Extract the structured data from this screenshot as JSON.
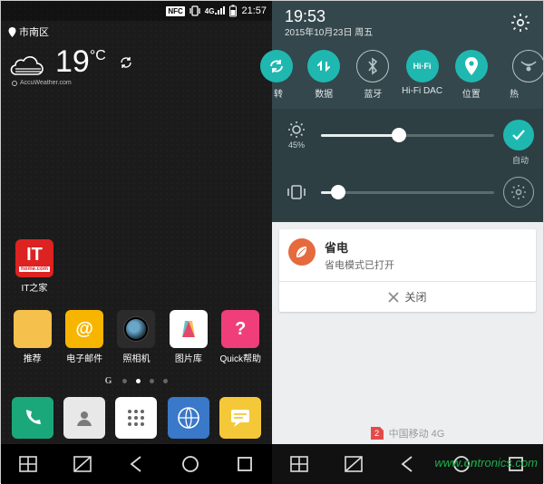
{
  "left": {
    "status": {
      "nfc": "NFC",
      "clock": "21:57"
    },
    "location": "市南区",
    "weather": {
      "temp": "19",
      "unit": "°C",
      "provider": "AccuWeather.com"
    },
    "apps_single": [
      {
        "label": "IT之家"
      }
    ],
    "apps_mid": [
      {
        "label": "推荐"
      },
      {
        "label": "电子邮件"
      },
      {
        "label": "照相机"
      },
      {
        "label": "图片库"
      },
      {
        "label": "Quick帮助"
      }
    ],
    "page_indicator_text": "G"
  },
  "right": {
    "clock": "19:53",
    "date": "2015年10月23日 周五",
    "toggles": [
      {
        "label": "转",
        "state": "on",
        "kind": "rotate"
      },
      {
        "label": "数据",
        "state": "on",
        "kind": "data"
      },
      {
        "label": "蓝牙",
        "state": "off",
        "kind": "bt"
      },
      {
        "label": "Hi-Fi DAC",
        "state": "on",
        "kind": "hifi",
        "text": "Hi·Fi"
      },
      {
        "label": "位置",
        "state": "on",
        "kind": "loc"
      },
      {
        "label": "热",
        "state": "off",
        "kind": "hotspot"
      }
    ],
    "brightness": {
      "percent_label": "45%",
      "percent": 45,
      "auto_label": "自动"
    },
    "volume": {
      "percent": 10
    },
    "notification": {
      "title": "省电",
      "body": "省电模式已打开",
      "close": "关闭"
    },
    "carrier": {
      "sim": "2",
      "name": "中国移动 4G"
    }
  },
  "watermark": "www.cntronics.com"
}
